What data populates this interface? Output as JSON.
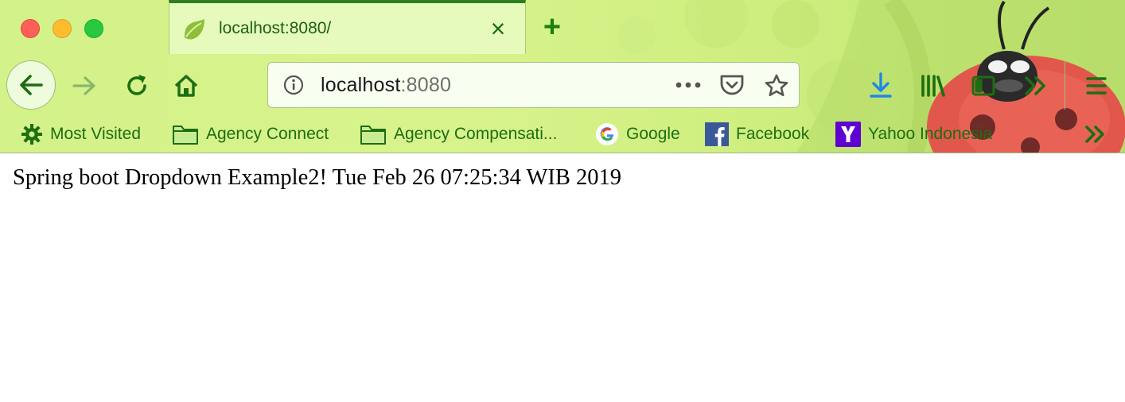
{
  "window": {
    "traffic_lights": {
      "close_color": "#fe5f57",
      "minimize_color": "#febc2e",
      "maximize_color": "#28c840"
    }
  },
  "tab": {
    "title": "localhost:8080/",
    "favicon": "spring-leaf-icon",
    "close_label": "×",
    "new_tab_label": "+"
  },
  "toolbar": {
    "back_icon": "arrow-left-icon",
    "forward_icon": "arrow-right-icon",
    "reload_icon": "reload-icon",
    "home_icon": "home-icon"
  },
  "urlbar": {
    "host": "localhost",
    "port": ":8080",
    "info_icon": "info-icon",
    "more_icon": "more-icon",
    "pocket_icon": "pocket-icon",
    "star_icon": "star-icon"
  },
  "toolbar_right": {
    "download_icon": "download-icon",
    "library_icon": "library-icon",
    "sidebar_icon": "sidebar-icon",
    "overflow_icon": "chevrons-right-icon",
    "menu_icon": "hamburger-icon"
  },
  "bookmarks": [
    {
      "label": "Most Visited",
      "icon": "gear-icon"
    },
    {
      "label": "Agency Connect",
      "icon": "folder-icon"
    },
    {
      "label": "Agency Compensati...",
      "icon": "folder-icon"
    },
    {
      "label": "Google",
      "icon": "google-icon"
    },
    {
      "label": "Facebook",
      "icon": "facebook-icon"
    },
    {
      "label": "Yahoo Indonesia",
      "icon": "yahoo-icon"
    }
  ],
  "bookmarks_overflow_icon": "chevrons-right-icon",
  "page": {
    "text": "Spring boot Dropdown Example2! Tue Feb 26 07:25:34 WIB 2019"
  },
  "theme": {
    "accent": "#1d7e12",
    "chrome_bg": "#d4f28a",
    "tab_bg": "#e6fbbb",
    "download_blue": "#1e88e5"
  }
}
